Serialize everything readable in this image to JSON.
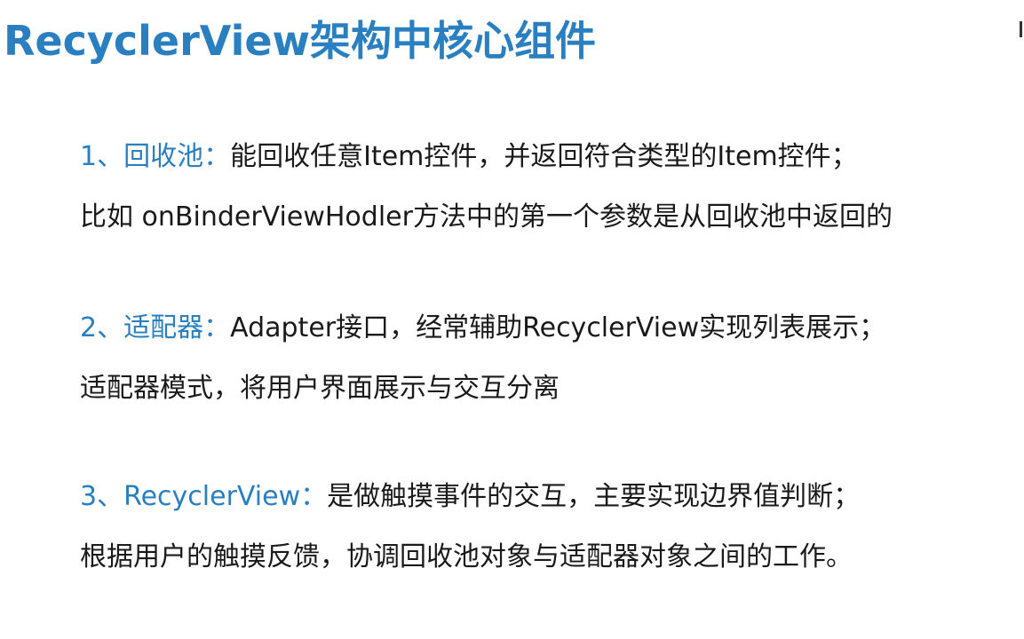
{
  "slide": {
    "title": "RecyclerView架构中核心组件",
    "colors": {
      "title": "#2a7fc1",
      "label": "#2a7fc1",
      "text": "#1a1a1a",
      "background": "#ffffff"
    },
    "items": [
      {
        "label": "1、回收池：",
        "text": "能回收任意Item控件，并返回符合类型的Item控件；",
        "detail": "比如 onBinderViewHodler方法中的第一个参数是从回收池中返回的"
      },
      {
        "label": "2、适配器：",
        "text": "Adapter接口，经常辅助RecyclerView实现列表展示；",
        "detail": "适配器模式，将用户界面展示与交互分离"
      },
      {
        "label": "3、RecyclerView：",
        "text": "是做触摸事件的交互，主要实现边界值判断；",
        "detail": "根据用户的触摸反馈，协调回收池对象与适配器对象之间的工作。"
      }
    ]
  }
}
